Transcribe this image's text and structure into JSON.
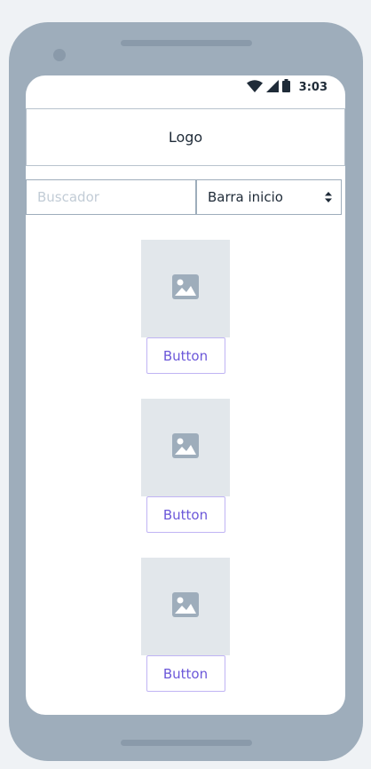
{
  "status_bar": {
    "time": "3:03",
    "icons": [
      "wifi-icon",
      "cell-signal-icon",
      "battery-icon"
    ]
  },
  "header": {
    "title": "Logo"
  },
  "search": {
    "placeholder": "Buscador",
    "value": ""
  },
  "nav_select": {
    "selected": "Barra inicio",
    "icon": "select-arrows-icon"
  },
  "cards": [
    {
      "image_icon": "image-placeholder-icon",
      "button_label": "Button"
    },
    {
      "image_icon": "image-placeholder-icon",
      "button_label": "Button"
    },
    {
      "image_icon": "image-placeholder-icon",
      "button_label": "Button"
    }
  ],
  "colors": {
    "device_frame": "#9eadbb",
    "screen_bg": "#ffffff",
    "placeholder_bg": "#e2e7eb",
    "button_text": "#6b57d9",
    "button_border": "#c0b4f4",
    "border": "#9eadbb"
  }
}
